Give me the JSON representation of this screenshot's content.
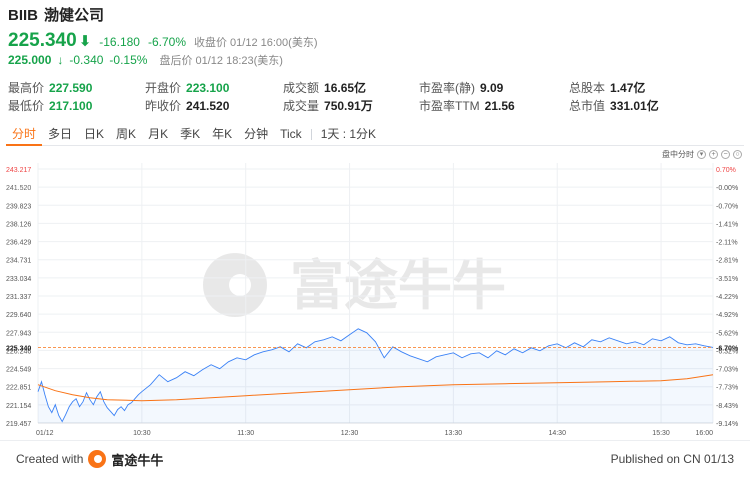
{
  "header": {
    "ticker": "BIIB",
    "name": "渤健公司",
    "price": "225.340",
    "arrow": "⬇",
    "change": "-16.180",
    "change_pct": "-6.70%",
    "close_status": "收盘价 01/12 16:00(美东)",
    "after_price": "225.000",
    "after_arrow": "↓",
    "after_change": "-0.340",
    "after_change_pct": "-0.15%",
    "after_status": "盘后价 01/12 18:23(美东)"
  },
  "stats": {
    "row1": [
      {
        "label": "最高价",
        "value": "227.590",
        "green": true
      },
      {
        "label": "开盘价",
        "value": "223.100",
        "green": true
      },
      {
        "label": "成交额",
        "value": "16.65亿",
        "green": false
      },
      {
        "label": "市盈率(静)",
        "value": "9.09",
        "green": false
      },
      {
        "label": "总股本",
        "value": "1.47亿",
        "green": false
      }
    ],
    "row2": [
      {
        "label": "最低价",
        "value": "217.100",
        "green": true
      },
      {
        "label": "昨收价",
        "value": "241.520",
        "green": false
      },
      {
        "label": "成交量",
        "value": "750.91万",
        "green": false
      },
      {
        "label": "市盈率TTM",
        "value": "21.56",
        "green": false
      },
      {
        "label": "总市值",
        "value": "331.01亿",
        "green": false
      }
    ]
  },
  "tabs": [
    "分时",
    "多日",
    "日K",
    "周K",
    "月K",
    "季K",
    "年K",
    "分钟",
    "Tick",
    "1天 : 1分K"
  ],
  "chart_options": {
    "label": "盘中分时",
    "icons": [
      "zoom-in-icon",
      "zoom-out-icon",
      "settings-icon"
    ]
  },
  "watermark": "富途牛牛",
  "footer": {
    "created": "Created with",
    "brand": "富途牛牛",
    "published": "Published on CN 01/13"
  },
  "colors": {
    "down": "#16a34a",
    "up": "#ef4444",
    "accent": "#f97316",
    "price_line": "#3b82f6",
    "avg_line": "#f97316"
  },
  "chart_data": {
    "type": "line",
    "prev_close": 241.52,
    "ylim": [
      217.762,
      243.217
    ],
    "y_ticks": [
      "243.217",
      "241.520",
      "239.823",
      "238.126",
      "236.429",
      "234.731",
      "233.034",
      "231.337",
      "229.640",
      "227.943",
      "226.246",
      "224.549",
      "222.851",
      "221.154",
      "219.457"
    ],
    "pct_ticks": [
      "0.70%",
      "-0.00%",
      "-0.70%",
      "-1.41%",
      "-2.11%",
      "-2.81%",
      "-3.51%",
      "-4.22%",
      "-4.92%",
      "-5.62%",
      "-6.32%",
      "-7.03%",
      "-7.73%",
      "-8.43%",
      "-9.14%"
    ],
    "x_ticks": [
      "01/12",
      "10:30",
      "11:30",
      "12:30",
      "13:30",
      "14:30",
      "15:30",
      "16:00"
    ],
    "current_price_label": "225.340",
    "current_pct_label": "-6.70%",
    "series": [
      {
        "id": "price",
        "minutes": [
          0,
          2,
          4,
          6,
          8,
          10,
          12,
          14,
          16,
          18,
          20,
          22,
          24,
          26,
          28,
          30,
          32,
          34,
          36,
          38,
          40,
          42,
          44,
          46,
          48,
          50,
          52,
          54,
          56,
          58,
          60,
          65,
          70,
          75,
          80,
          85,
          90,
          95,
          100,
          105,
          110,
          115,
          120,
          125,
          130,
          135,
          140,
          145,
          150,
          155,
          160,
          165,
          170,
          175,
          180,
          185,
          190,
          195,
          200,
          205,
          210,
          215,
          220,
          225,
          230,
          235,
          240,
          245,
          250,
          255,
          260,
          265,
          270,
          275,
          280,
          285,
          290,
          295,
          300,
          305,
          310,
          315,
          320,
          325,
          330,
          335,
          340,
          345,
          350,
          355,
          360,
          365,
          370,
          375,
          380,
          385,
          390
        ],
        "values": [
          220.9,
          221.9,
          220.6,
          219.4,
          218.8,
          219.6,
          218.5,
          217.9,
          218.6,
          219.4,
          219.9,
          220.2,
          219.4,
          219.9,
          220.8,
          220.1,
          219.6,
          220.4,
          220.9,
          219.9,
          219.3,
          218.9,
          218.5,
          219.1,
          219.4,
          219.0,
          219.6,
          219.8,
          220.2,
          220.6,
          220.9,
          221.6,
          222.6,
          221.9,
          222.3,
          222.9,
          222.5,
          223.1,
          223.6,
          223.2,
          223.9,
          224.3,
          224.1,
          224.6,
          224.9,
          225.1,
          225.4,
          224.9,
          225.7,
          225.3,
          225.9,
          226.1,
          226.4,
          226.0,
          226.6,
          227.2,
          226.8,
          225.9,
          224.3,
          225.4,
          224.9,
          224.5,
          224.2,
          223.9,
          224.4,
          224.6,
          224.8,
          224.3,
          224.7,
          224.8,
          224.3,
          225.0,
          224.6,
          225.2,
          224.8,
          225.3,
          225.0,
          225.5,
          225.7,
          225.3,
          225.8,
          225.4,
          226.1,
          225.9,
          226.3,
          226.0,
          225.7,
          225.9,
          225.6,
          226.2,
          226.0,
          226.4,
          225.8,
          225.6,
          225.7,
          225.5,
          225.34
        ]
      },
      {
        "id": "avg",
        "minutes": [
          0,
          10,
          20,
          30,
          40,
          60,
          80,
          100,
          120,
          150,
          180,
          210,
          240,
          270,
          300,
          330,
          360,
          375,
          390
        ],
        "values": [
          221.6,
          221.0,
          220.6,
          220.3,
          220.1,
          220.0,
          220.1,
          220.3,
          220.5,
          220.8,
          221.1,
          221.4,
          221.6,
          221.7,
          221.8,
          221.9,
          222.0,
          222.2,
          222.6
        ]
      }
    ]
  }
}
